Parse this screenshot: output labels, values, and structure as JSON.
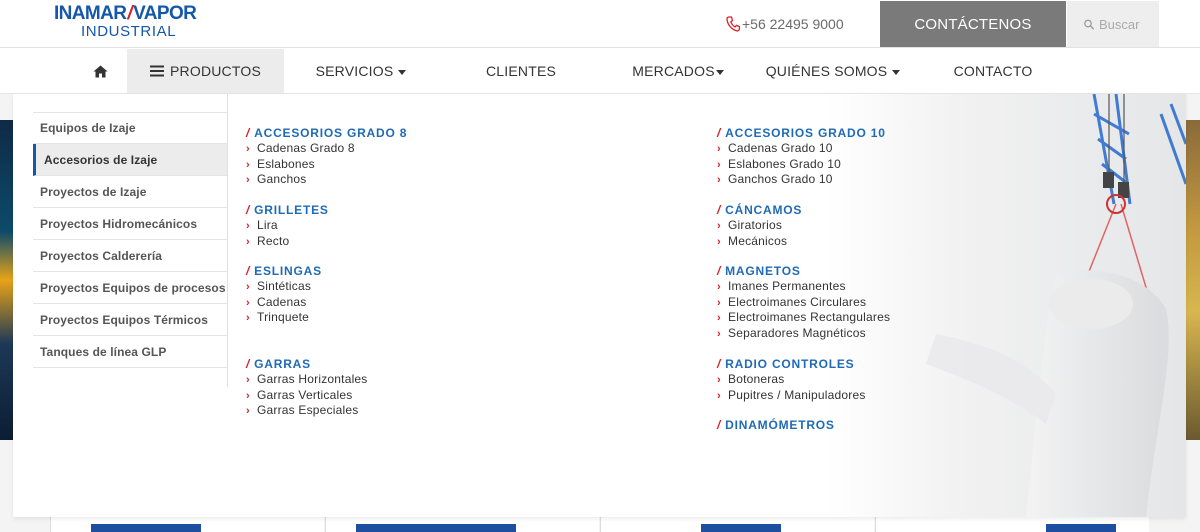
{
  "header": {
    "logo_top_left": "INAMAR",
    "logo_top_right": "VAPOR",
    "logo_bottom": "INDUSTRIAL",
    "phone": "+56 22495 9000",
    "contact_button": "CONTÁCTENOS",
    "search_placeholder": "Buscar",
    "brand_blue": "#1557a8",
    "brand_red": "#d8232a"
  },
  "nav": {
    "items": [
      {
        "label": "PRODUCTOS"
      },
      {
        "label": "SERVICIOS"
      },
      {
        "label": "CLIENTES"
      },
      {
        "label": "MERCADOS"
      },
      {
        "label": "QUIÉNES SOMOS"
      },
      {
        "label": "CONTACTO"
      }
    ]
  },
  "sidebar": {
    "items": [
      {
        "label": "Equipos de Izaje"
      },
      {
        "label": "Accesorios de Izaje"
      },
      {
        "label": "Proyectos de Izaje"
      },
      {
        "label": "Proyectos Hidromecánicos"
      },
      {
        "label": "Proyectos Calderería"
      },
      {
        "label": "Proyectos Equipos de procesos"
      },
      {
        "label": "Proyectos Equipos Térmicos"
      },
      {
        "label": "Tanques de línea GLP"
      }
    ],
    "active_item": "Accesorios de Izaje"
  },
  "categories": {
    "left": [
      {
        "title": "ACCESORIOS GRADO 8",
        "links": [
          "Cadenas Grado 8",
          "Eslabones",
          "Ganchos"
        ]
      },
      {
        "title": "GRILLETES",
        "links": [
          "Lira",
          "Recto"
        ]
      },
      {
        "title": "ESLINGAS",
        "links": [
          "Sintéticas",
          "Cadenas",
          "Trinquete"
        ]
      },
      {
        "title": "GARRAS",
        "links": [
          "Garras Horizontales",
          "Garras Verticales",
          "Garras Especiales"
        ]
      }
    ],
    "right": [
      {
        "title": "ACCESORIOS GRADO 10",
        "links": [
          "Cadenas Grado 10",
          "Eslabones Grado 10",
          "Ganchos Grado 10"
        ]
      },
      {
        "title": "CÁNCAMOS",
        "links": [
          "Giratorios",
          "Mecánicos"
        ]
      },
      {
        "title": "MAGNETOS",
        "links": [
          "Imanes Permanentes",
          "Electroimanes Circulares",
          "Electroimanes Rectangulares",
          "Separadores Magnéticos"
        ]
      },
      {
        "title": "RADIO CONTROLES",
        "links": [
          "Botoneras",
          "Pupitres / Manipuladores"
        ]
      },
      {
        "title": "DINAMÓMETROS",
        "links": []
      }
    ]
  },
  "icons": {
    "home": "home-icon",
    "menu": "hamburger-icon",
    "phone": "phone-icon",
    "search": "search-icon"
  }
}
